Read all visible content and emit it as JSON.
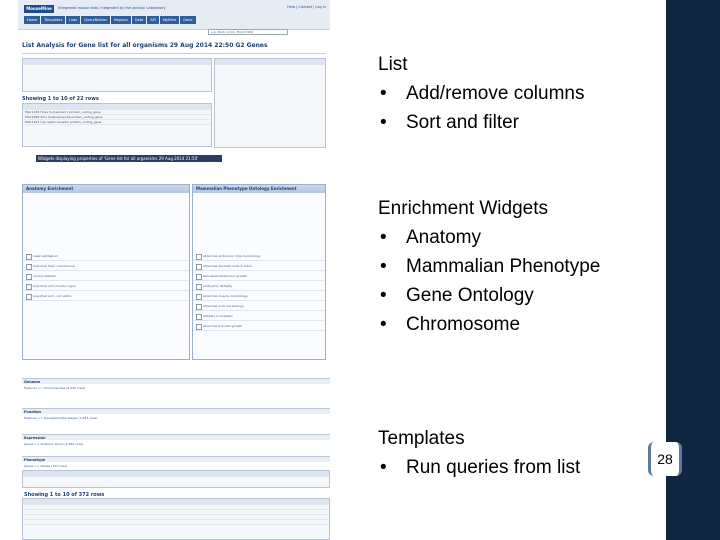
{
  "screenshot": {
    "logo": "MouseMine",
    "tagline": "Integrated mouse data, integrated by the Jackson Laboratory",
    "top_links": "Help | Contact | Log in",
    "nav_tabs": [
      "Home",
      "Templates",
      "Lists",
      "QueryBuilder",
      "Regions",
      "Data",
      "API",
      "MyMine",
      "Gene"
    ],
    "search_placeholder": "e.g. Pax6, Arm1, MGI:97490",
    "page_title": "List Analysis for Gene list for all organisms 29 Aug 2014 22:50 G2 Genes",
    "table_title": "Showing 1 to 10 of 22 rows",
    "table_rows": [
      "MGI:1915 Hoxa humanized 1 protein_coding_gene",
      "MGI:9956 Smo SoleneAmpulla protein_coding_gene",
      "MGI:1911 Cyp leptin receptor protein_coding_gene"
    ],
    "widgets_bar": "Widgets displaying properties of 'Gene list for all organisms 29 Aug 2014 21:50'",
    "anatomy_title": "Anatomy Enrichment",
    "anatomy_rows": [
      "nasal epithelium",
      "branchial fluid, cranial bone",
      "urinary bladder",
      "branchial arch muscle organ",
      "branchial arch, cut nation"
    ],
    "phenotype_title": "Mammalian Phenotype Ontology Enrichment",
    "phenotype_rows": [
      "abnormal embryonic limb morphology",
      "abnormal dendritic branch arbor",
      "decreased embryonic growth",
      "embryonic lethality",
      "abnormal muscle morphology",
      "abnormal joint morphology",
      "lethality (complete)",
      "abnormal prenatal growth"
    ],
    "sections": [
      "Genome",
      "Function",
      "Expression",
      "Phenotype"
    ],
    "section_lines": [
      "Features >> Chromosomes (2,345 rows)",
      "Features >> Developmental stages (1,223 rows)",
      "Genes >> Anatomy terms (1,982 rows)",
      "Genes >> Alleles (753 rows)"
    ],
    "bottom_table_title": "Showing 1 to 10 of 372 rows"
  },
  "slide": {
    "block1": {
      "heading": "List",
      "bullets": [
        "Add/remove columns",
        "Sort and filter"
      ]
    },
    "block2": {
      "heading": "Enrichment Widgets",
      "bullets": [
        "Anatomy",
        "Mammalian Phenotype",
        "Gene Ontology",
        "Chromosome"
      ]
    },
    "block3": {
      "heading": "Templates",
      "bullets": [
        "Run queries from list"
      ]
    },
    "page_number": "28"
  },
  "colors": {
    "band": "#0f2540",
    "accent": "#1d4d8c"
  }
}
